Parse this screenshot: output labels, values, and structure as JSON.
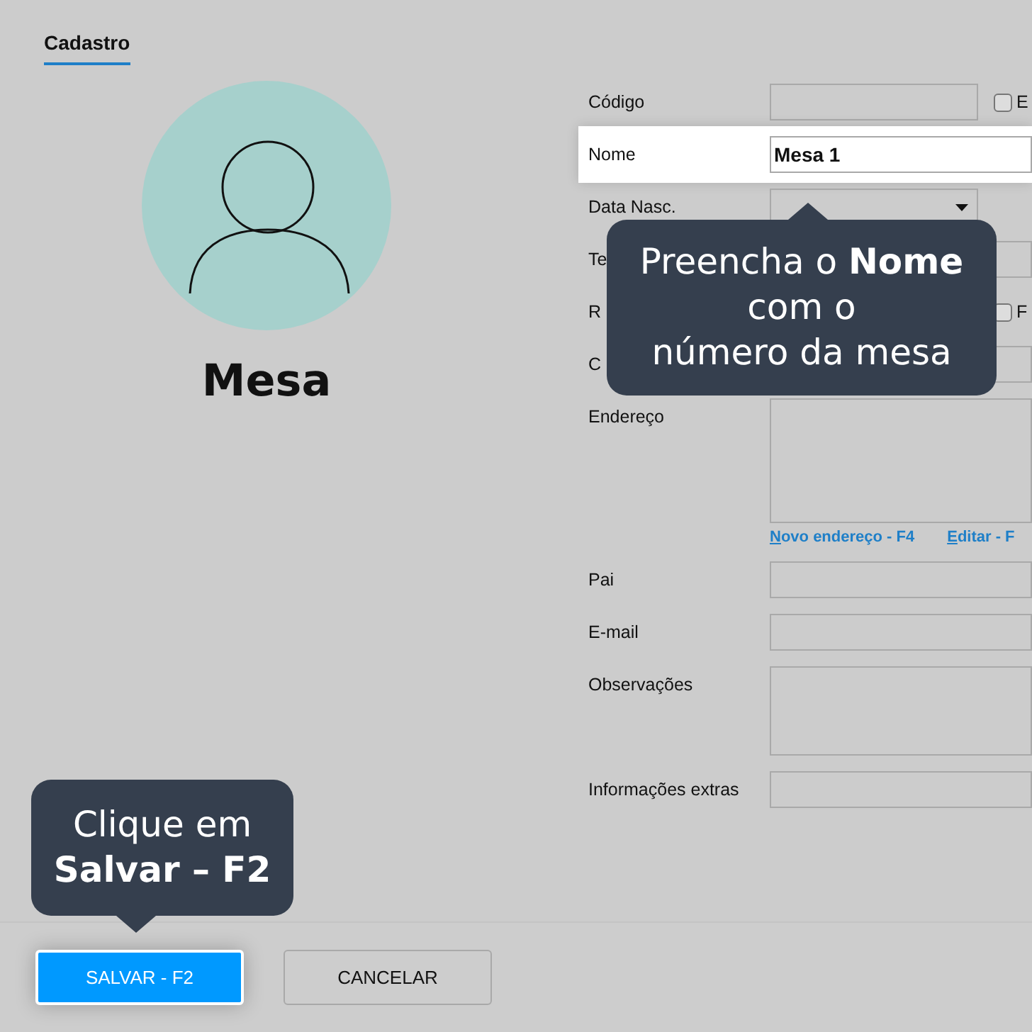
{
  "tabs": [
    {
      "label": "Cadastro",
      "selected": true
    }
  ],
  "profile": {
    "name": "Mesa"
  },
  "form": [
    {
      "label": "Código",
      "kind": "short",
      "highlighted": false,
      "checkbox": {
        "label": "E",
        "checked": false
      }
    },
    {
      "label": "Nome",
      "kind": "text",
      "value": "Mesa 1",
      "highlighted": true
    },
    {
      "label": "Data Nasc.",
      "kind": "select",
      "highlighted": false
    },
    {
      "label": "Te",
      "kind": "text",
      "highlighted": false
    },
    {
      "label": "R",
      "kind": "covered",
      "highlighted": false,
      "checkbox": {
        "label": "F",
        "checked": false
      }
    },
    {
      "label": "C",
      "kind": "text",
      "highlighted": false
    },
    {
      "label": "Endereço",
      "kind": "textarea",
      "highlighted": false,
      "links": [
        {
          "key": "N",
          "rest": "ovo endereço - F4"
        },
        {
          "key": "E",
          "rest": "ditar - F"
        }
      ]
    },
    {
      "label": "Pai",
      "kind": "text",
      "highlighted": false
    },
    {
      "label": "E-mail",
      "kind": "text",
      "highlighted": false
    },
    {
      "label": "Observações",
      "kind": "textarea",
      "highlighted": false
    },
    {
      "label": "Informações extras",
      "kind": "text",
      "highlighted": false
    }
  ],
  "tooltips": [
    {
      "lines": [
        "Preencha o **Nome**",
        "com o",
        "número da mesa"
      ]
    },
    {
      "lines": [
        "Clique em",
        "**Salvar – F2**"
      ]
    }
  ],
  "buttons": [
    {
      "label": "SALVAR - F2",
      "kind": "primary"
    },
    {
      "label": "CANCELAR",
      "kind": "secondary"
    }
  ]
}
